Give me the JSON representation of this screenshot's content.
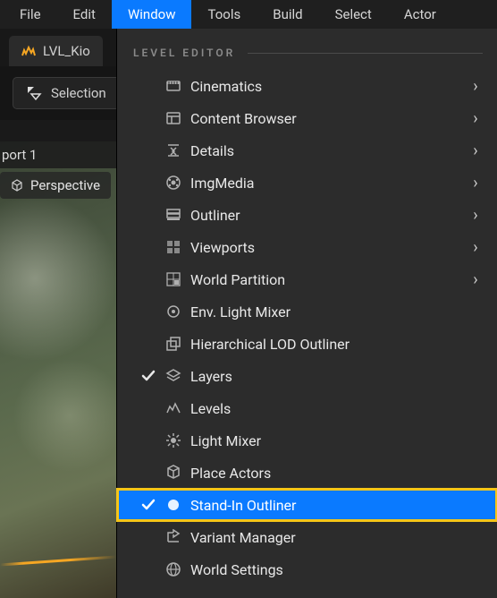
{
  "menubar": {
    "items": [
      {
        "label": "File"
      },
      {
        "label": "Edit"
      },
      {
        "label": "Window"
      },
      {
        "label": "Tools"
      },
      {
        "label": "Build"
      },
      {
        "label": "Select"
      },
      {
        "label": "Actor"
      }
    ],
    "active_index": 2
  },
  "tab": {
    "label": "LVL_Kio"
  },
  "selection_button": {
    "label": "Selection"
  },
  "viewport_tab": {
    "label": "port 1"
  },
  "perspective_button": {
    "label": "Perspective"
  },
  "dropdown": {
    "section_label": "LEVEL EDITOR",
    "items": [
      {
        "icon": "cinematics-icon",
        "label": "Cinematics",
        "submenu": true
      },
      {
        "icon": "content-browser-icon",
        "label": "Content Browser",
        "submenu": true
      },
      {
        "icon": "details-icon",
        "label": "Details",
        "submenu": true
      },
      {
        "icon": "imgmedia-icon",
        "label": "ImgMedia",
        "submenu": true
      },
      {
        "icon": "outliner-icon",
        "label": "Outliner",
        "submenu": true
      },
      {
        "icon": "viewports-icon",
        "label": "Viewports",
        "submenu": true
      },
      {
        "icon": "world-partition-icon",
        "label": "World Partition",
        "submenu": true
      },
      {
        "icon": "env-light-mixer-icon",
        "label": "Env. Light Mixer"
      },
      {
        "icon": "hlod-outliner-icon",
        "label": "Hierarchical LOD Outliner"
      },
      {
        "icon": "layers-icon",
        "label": "Layers",
        "checked": true
      },
      {
        "icon": "levels-icon",
        "label": "Levels"
      },
      {
        "icon": "light-mixer-icon",
        "label": "Light Mixer"
      },
      {
        "icon": "place-actors-icon",
        "label": "Place Actors"
      },
      {
        "icon": "standin-outliner-icon",
        "label": "Stand-In Outliner",
        "checked": true,
        "highlight": true,
        "boxed": true
      },
      {
        "icon": "variant-manager-icon",
        "label": "Variant Manager"
      },
      {
        "icon": "world-settings-icon",
        "label": "World Settings"
      }
    ]
  }
}
